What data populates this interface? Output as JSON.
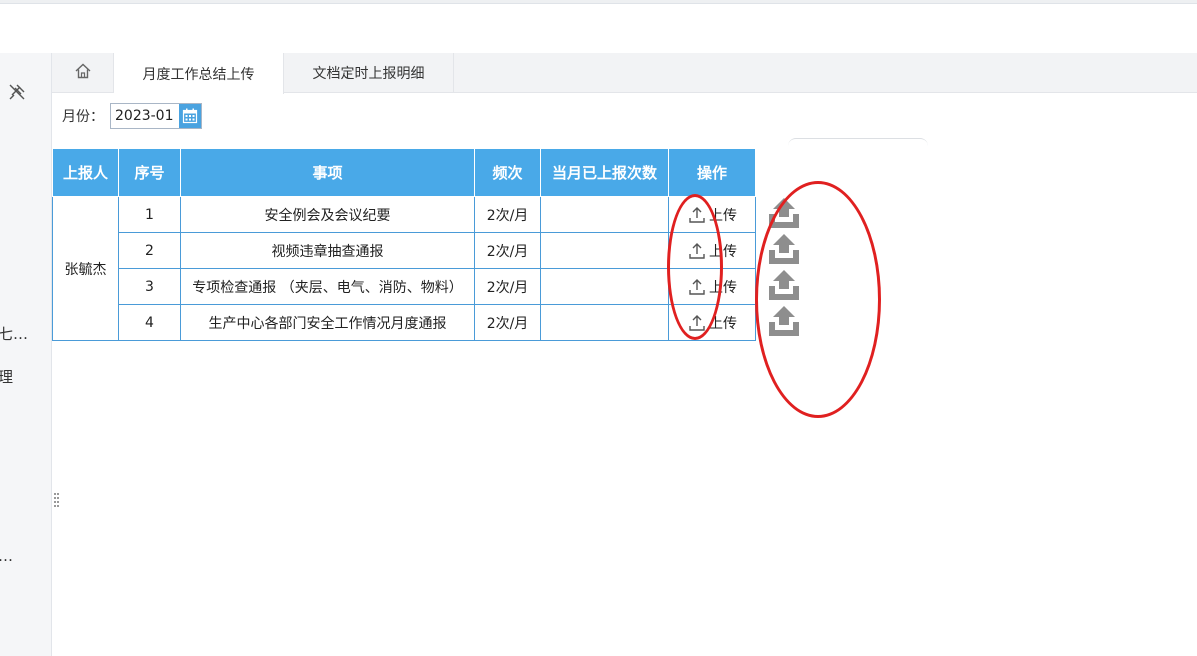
{
  "app": {
    "tabs": [
      {
        "label": "月度工作总结上传"
      },
      {
        "label": "文档定时上报明细"
      }
    ],
    "left_rail": {
      "fragments": [
        "七…",
        "理",
        "…"
      ]
    }
  },
  "filter": {
    "month_label": "月份：",
    "month_value": "2023-01"
  },
  "table": {
    "columns": [
      "上报人",
      "序号",
      "事项",
      "频次",
      "当月已上报次数",
      "操作"
    ],
    "reporter": "张毓杰",
    "rows": [
      {
        "no": "1",
        "item": "安全例会及会议纪要",
        "freq": "2次/月",
        "count": "",
        "action": "上传"
      },
      {
        "no": "2",
        "item": "视频违章抽查通报",
        "freq": "2次/月",
        "count": "",
        "action": "上传"
      },
      {
        "no": "3",
        "item": "专项检查通报  （夹层、电气、消防、物料）",
        "freq": "2次/月",
        "count": "",
        "action": "上传"
      },
      {
        "no": "4",
        "item": "生产中心各部门安全工作情况月度通报",
        "freq": "2次/月",
        "count": "",
        "action": "上传"
      }
    ]
  },
  "icons": {
    "home": "home-icon",
    "calendar": "calendar-icon",
    "upload": "upload-icon",
    "tray_upload": "tray-upload-icon",
    "pin": "pin-icon"
  },
  "colors": {
    "header_bg": "#49a9e8",
    "border": "#4a9bd8",
    "annotation": "#e02020"
  }
}
